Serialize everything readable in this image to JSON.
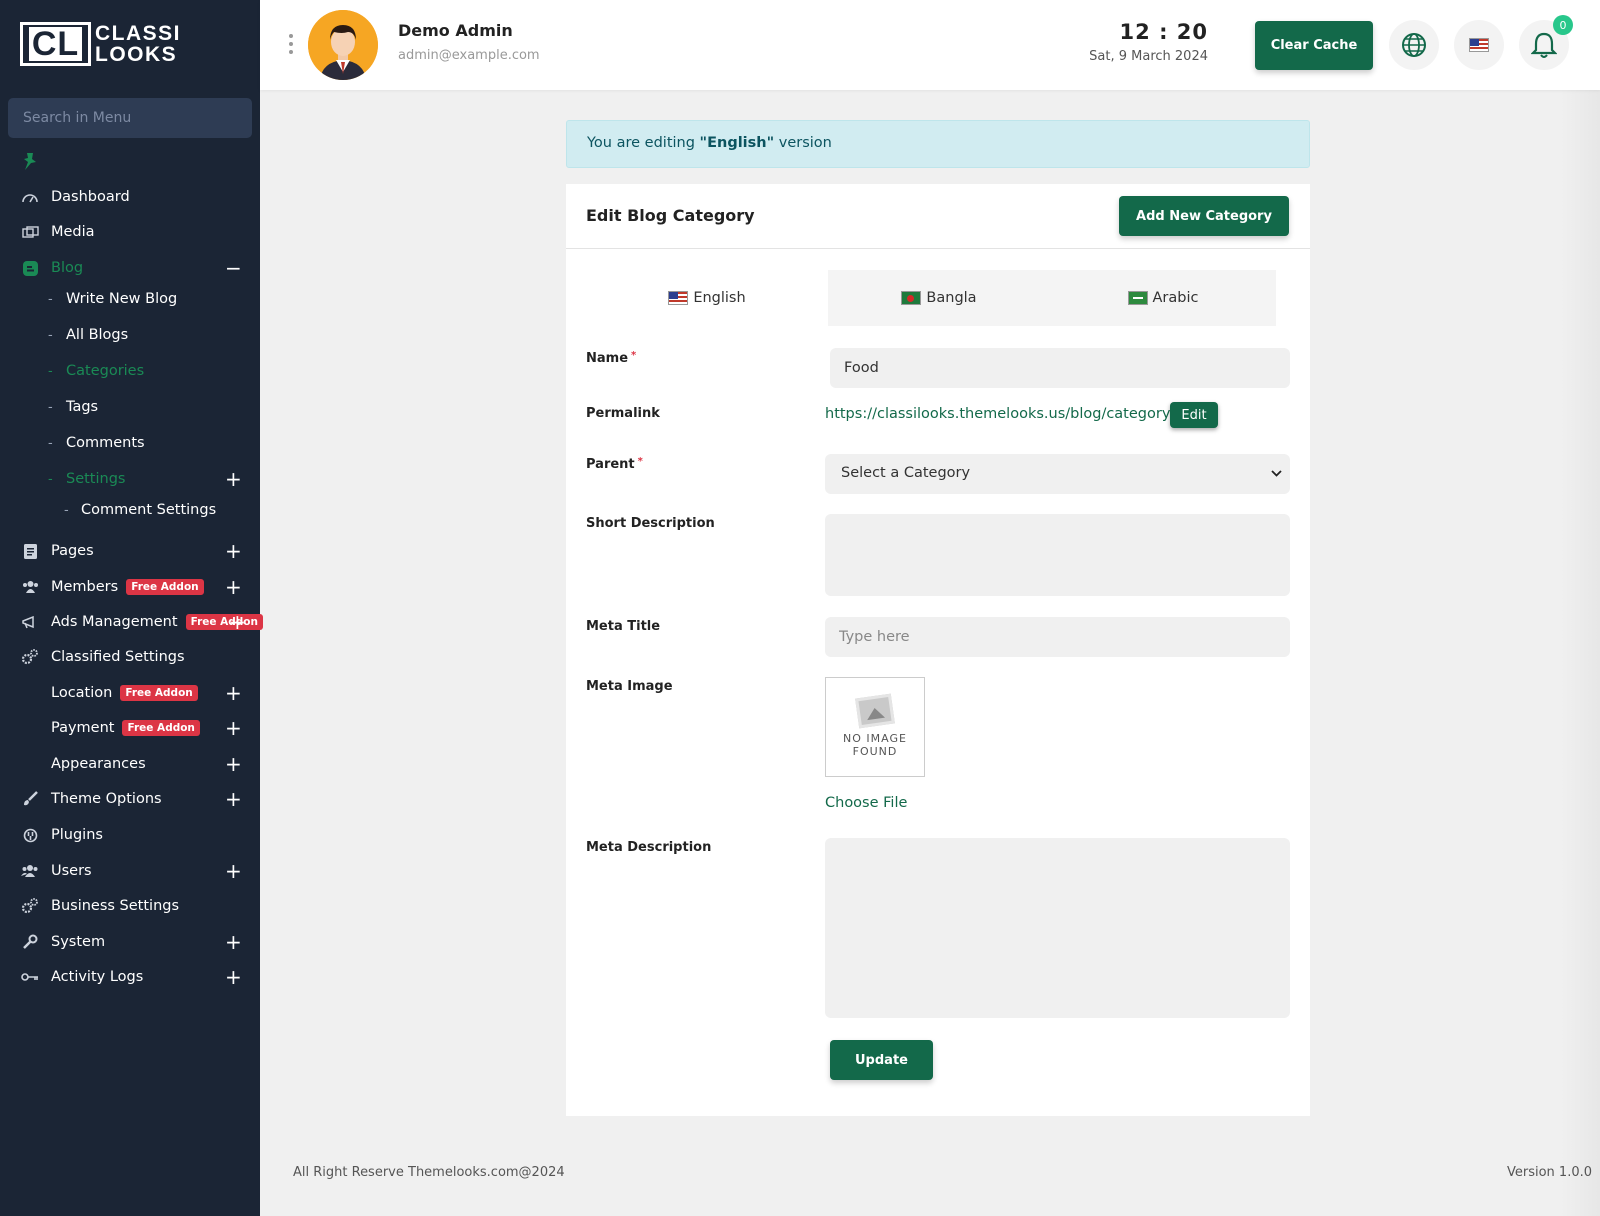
{
  "brand": {
    "logo_initials": "CL",
    "logo_line1": "CLASSI",
    "logo_line2": "LOOKS"
  },
  "sidebar": {
    "search_placeholder": "Search in Menu",
    "items": [
      {
        "label": "Dashboard",
        "icon": "dashboard-icon"
      },
      {
        "label": "Media",
        "icon": "media-icon"
      },
      {
        "label": "Blog",
        "icon": "blog-icon",
        "expanded": true
      },
      {
        "label": "Write New Blog"
      },
      {
        "label": "All Blogs"
      },
      {
        "label": "Categories",
        "active": true
      },
      {
        "label": "Tags"
      },
      {
        "label": "Comments"
      },
      {
        "label": "Settings"
      },
      {
        "label": "Comment Settings"
      },
      {
        "label": "Pages",
        "icon": "pages-icon"
      },
      {
        "label": "Members",
        "badge": "Free Addon"
      },
      {
        "label": "Ads Management",
        "badge": "Free Addon"
      },
      {
        "label": "Classified Settings"
      },
      {
        "label": "Location",
        "badge": "Free Addon"
      },
      {
        "label": "Payment",
        "badge": "Free Addon"
      },
      {
        "label": "Appearances"
      },
      {
        "label": "Theme Options"
      },
      {
        "label": "Plugins"
      },
      {
        "label": "Users"
      },
      {
        "label": "Business Settings"
      },
      {
        "label": "System"
      },
      {
        "label": "Activity Logs"
      }
    ],
    "collapse_symbol": "−",
    "expand_symbol": "+"
  },
  "header": {
    "user_name": "Demo Admin",
    "user_email": "admin@example.com",
    "time": "12 : 20",
    "date": "Sat, 9 March 2024",
    "clear_cache_label": "Clear Cache",
    "notification_count": "0"
  },
  "alert": {
    "prefix": "You are editing ",
    "language": "\"English\"",
    "suffix": " version"
  },
  "form": {
    "title": "Edit Blog Category",
    "add_new_label": "Add New Category",
    "tabs": [
      {
        "label": "English",
        "flag": "us",
        "active": true
      },
      {
        "label": "Bangla",
        "flag": "bd"
      },
      {
        "label": "Arabic",
        "flag": "sa"
      }
    ],
    "name_label": "Name",
    "name_value": "Food",
    "permalink_label": "Permalink",
    "permalink_value": "https://classilooks.themelooks.us/blog/category/food",
    "permalink_edit_label": "Edit",
    "parent_label": "Parent",
    "parent_value": "Select a Category",
    "short_description_label": "Short Description",
    "meta_title_label": "Meta Title",
    "meta_title_placeholder": "Type here",
    "meta_image_label": "Meta Image",
    "no_image_line1": "NO IMAGE",
    "no_image_line2": "FOUND",
    "choose_file_label": "Choose File",
    "meta_description_label": "Meta Description",
    "update_label": "Update",
    "required_mark": "*"
  },
  "footer": {
    "copyright": "All Right Reserve Themelooks.com@2024",
    "version": "Version 1.0.0"
  },
  "colors": {
    "sidebar_bg": "#1b2535",
    "accent_green": "#13694a",
    "active_green": "#1a8a55",
    "badge_red": "#dc3545",
    "alert_bg": "#d1ecf1"
  }
}
